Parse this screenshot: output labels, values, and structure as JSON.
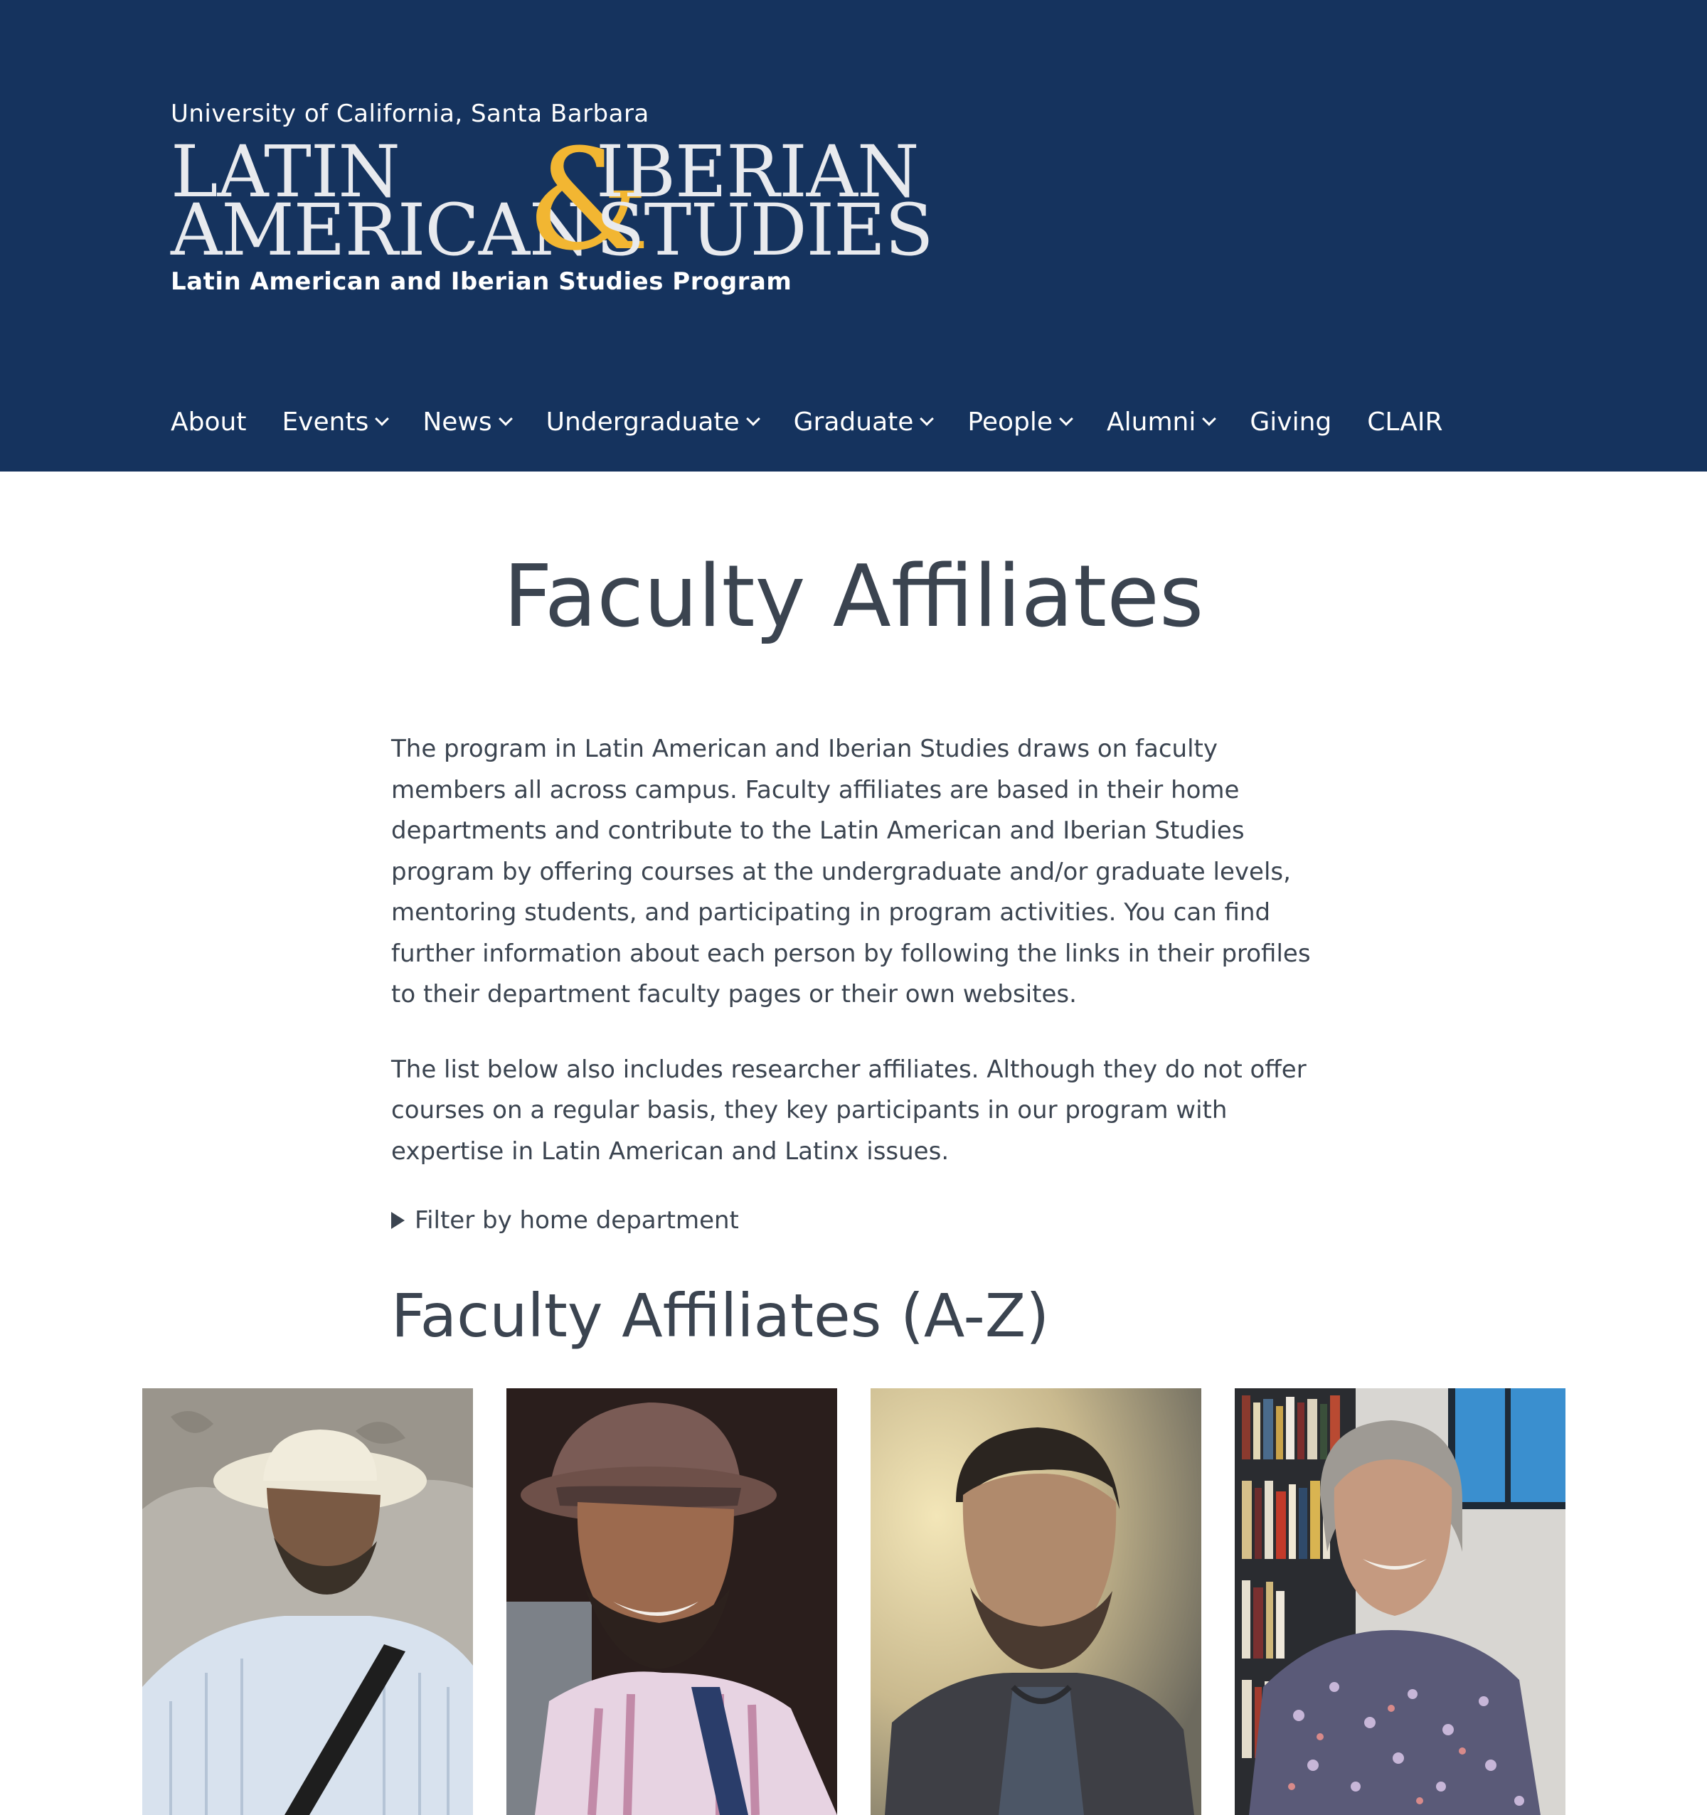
{
  "header": {
    "university": "University of California, Santa Barbara",
    "logo_words": {
      "latin": "LATIN",
      "american": "AMERICAN",
      "iberian": "IBERIAN",
      "studies": "STUDIES",
      "ampersand": "&"
    },
    "program_name": "Latin American and Iberian Studies Program",
    "background_color": "#15335e",
    "accent_color": "#f2b632"
  },
  "nav": {
    "items": [
      {
        "label": "About",
        "has_dropdown": false
      },
      {
        "label": "Events",
        "has_dropdown": true
      },
      {
        "label": "News",
        "has_dropdown": true
      },
      {
        "label": "Undergraduate",
        "has_dropdown": true
      },
      {
        "label": "Graduate",
        "has_dropdown": true
      },
      {
        "label": "People",
        "has_dropdown": true
      },
      {
        "label": "Alumni",
        "has_dropdown": true
      },
      {
        "label": "Giving",
        "has_dropdown": false
      },
      {
        "label": "CLAIR",
        "has_dropdown": false
      }
    ]
  },
  "main": {
    "title": "Faculty Affiliates",
    "intro_paragraphs": [
      "The program in Latin American and Iberian Studies draws on faculty members all across campus. Faculty affiliates are based in their home departments and contribute to the Latin American and Iberian Studies program by offering courses at the undergraduate and/or graduate levels, mentoring students, and participating in program activities. You can find further information about each person by following the links in their profiles to their department faculty pages or their own websites.",
      "The list below also includes researcher affiliates. Although they do not offer courses on a regular basis, they key participants in our program with expertise in Latin American and Latinx issues."
    ],
    "filter_label": "Filter by home department",
    "section_title": "Faculty Affiliates (A-Z)",
    "photos": [
      {
        "icon": "portrait-photo"
      },
      {
        "icon": "portrait-photo"
      },
      {
        "icon": "portrait-photo"
      },
      {
        "icon": "portrait-photo"
      }
    ]
  }
}
